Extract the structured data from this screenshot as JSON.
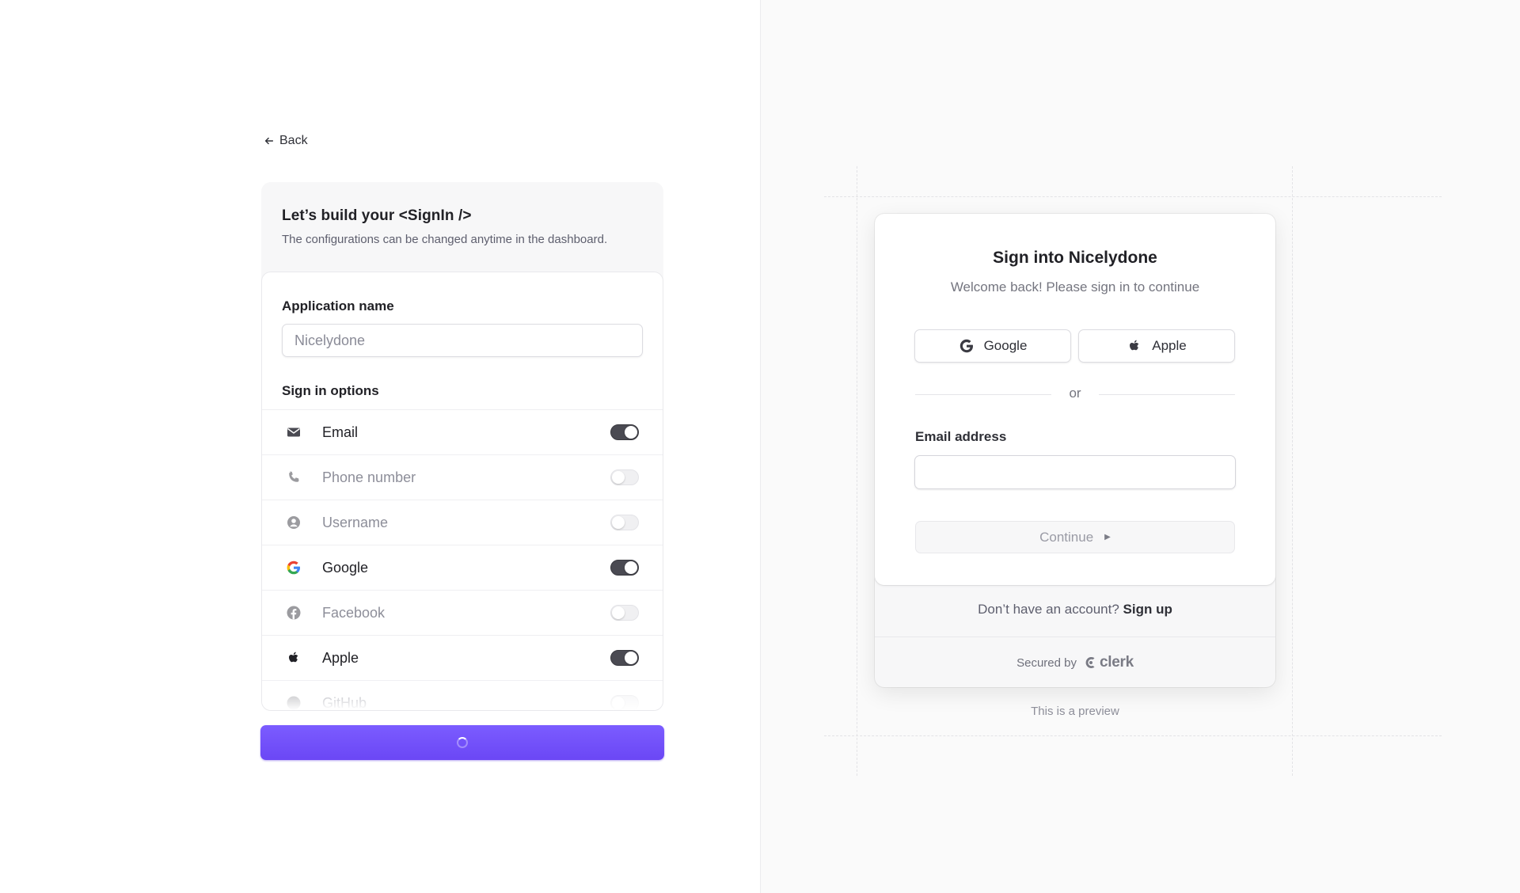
{
  "builder": {
    "back_label": "Back",
    "title": "Let’s build your <SignIn />",
    "subtitle": "The configurations can be changed anytime in the dashboard.",
    "app_name_label": "Application name",
    "app_name_value": "Nicelydone",
    "sign_in_options_label": "Sign in options",
    "options": [
      {
        "label": "Email",
        "icon": "mail-icon",
        "enabled": true
      },
      {
        "label": "Phone number",
        "icon": "phone-icon",
        "enabled": false
      },
      {
        "label": "Username",
        "icon": "user-circle-icon",
        "enabled": false
      },
      {
        "label": "Google",
        "icon": "google-icon",
        "enabled": true
      },
      {
        "label": "Facebook",
        "icon": "facebook-icon",
        "enabled": false
      },
      {
        "label": "Apple",
        "icon": "apple-icon",
        "enabled": true
      },
      {
        "label": "GitHub",
        "icon": "github-icon",
        "enabled": false
      }
    ],
    "submit_state": "loading"
  },
  "preview": {
    "title": "Sign into Nicelydone",
    "subtitle": "Welcome back! Please sign in to continue",
    "google_label": "Google",
    "apple_label": "Apple",
    "divider_text": "or",
    "email_label": "Email address",
    "email_value": "",
    "continue_label": "Continue",
    "no_account_text": "Don’t have an account?",
    "sign_up_label": "Sign up",
    "secured_by": "Secured by",
    "clerk_brand": "clerk",
    "preview_note": "This is a preview"
  },
  "colors": {
    "accent": "#6b47f5",
    "toggle_on": "#4a4a52",
    "page_bg_right": "#fafafa"
  }
}
